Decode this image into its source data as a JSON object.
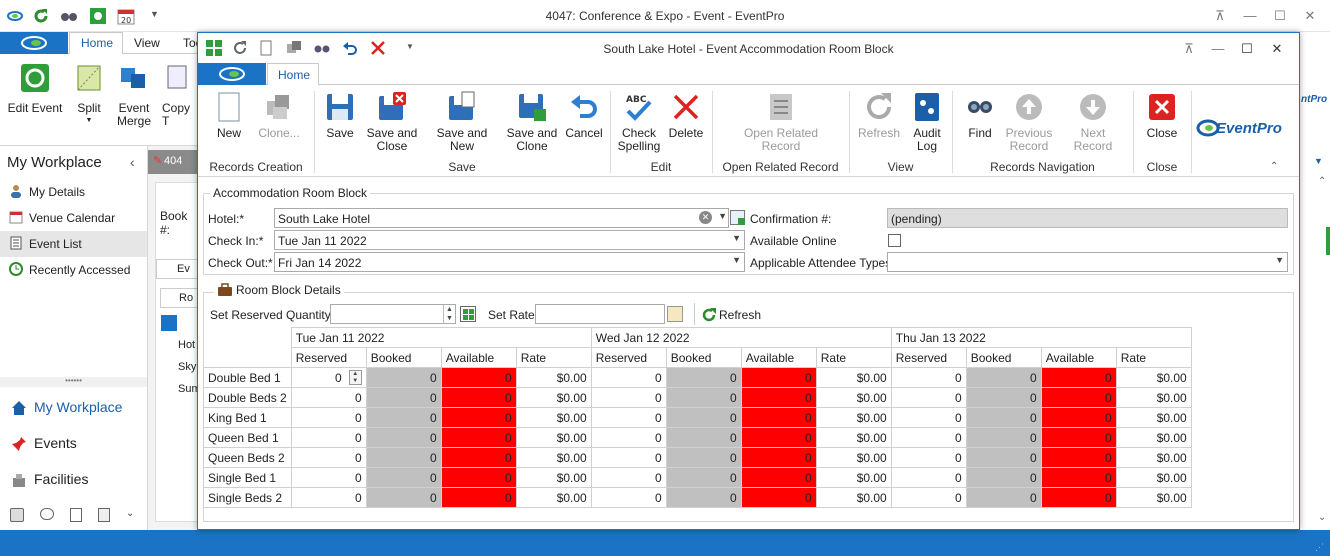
{
  "main_window": {
    "title": "4047: Conference & Expo - Event - EventPro",
    "tabs": [
      "Home",
      "View",
      "Too"
    ],
    "ribbon": [
      {
        "label": "Edit Event"
      },
      {
        "label": "Split"
      },
      {
        "label": "Event Merge"
      },
      {
        "label": "Copy T"
      }
    ]
  },
  "sidebar": {
    "title": "My Workplace",
    "items": [
      "My Details",
      "Venue Calendar",
      "Event List",
      "Recently Accessed"
    ],
    "nav": [
      "My Workplace",
      "Events",
      "Facilities"
    ]
  },
  "background_panel": {
    "tab_label": "404",
    "book_label": "Book #:",
    "tab2": "Ev",
    "tab3": "Ro",
    "rows": [
      "Hot",
      "Sky",
      "Sum"
    ]
  },
  "child_window": {
    "title": "South Lake Hotel - Event Accommodation Room Block",
    "tab": "Home",
    "ribbon": {
      "buttons": [
        {
          "id": "new",
          "label": "New"
        },
        {
          "id": "clone",
          "label": "Clone..."
        },
        {
          "id": "save",
          "label": "Save"
        },
        {
          "id": "save_close",
          "label": "Save and Close"
        },
        {
          "id": "save_new",
          "label": "Save and New"
        },
        {
          "id": "save_clone",
          "label": "Save and Clone"
        },
        {
          "id": "cancel",
          "label": "Cancel"
        },
        {
          "id": "check_spelling",
          "label": "Check Spelling"
        },
        {
          "id": "delete",
          "label": "Delete"
        },
        {
          "id": "open_related",
          "label": "Open Related Record"
        },
        {
          "id": "refresh",
          "label": "Refresh"
        },
        {
          "id": "audit_log",
          "label": "Audit Log"
        },
        {
          "id": "find",
          "label": "Find"
        },
        {
          "id": "prev",
          "label": "Previous Record"
        },
        {
          "id": "next",
          "label": "Next Record"
        },
        {
          "id": "close",
          "label": "Close"
        }
      ],
      "groups": [
        "Records Creation",
        "Save",
        "Edit",
        "Open Related Record",
        "View",
        "Records Navigation",
        "Close"
      ],
      "logo_text": "EventPro"
    },
    "form": {
      "section_title": "Accommodation Room Block",
      "hotel_label": "Hotel:*",
      "hotel_value": "South Lake Hotel",
      "checkin_label": "Check In:*",
      "checkin_value": "Tue Jan 11 2022",
      "checkout_label": "Check Out:*",
      "checkout_value": "Fri Jan 14 2022",
      "confirmation_label": "Confirmation #:",
      "confirmation_value": "(pending)",
      "available_online_label": "Available Online",
      "attendee_types_label": "Applicable Attendee Types:",
      "attendee_types_value": ""
    },
    "room_block": {
      "section_title": "Room Block Details",
      "set_qty_label": "Set Reserved Quantity",
      "set_rate_label": "Set Rate",
      "refresh_label": "Refresh",
      "dates": [
        "Tue Jan 11 2022",
        "Wed Jan 12 2022",
        "Thu Jan 13 2022"
      ],
      "columns": [
        "Reserved",
        "Booked",
        "Available",
        "Rate"
      ],
      "rows": [
        {
          "room": "Double Bed 1",
          "values": [
            "0",
            "0",
            "0",
            "$0.00",
            "0",
            "0",
            "0",
            "$0.00",
            "0",
            "0",
            "0",
            "$0.00"
          ]
        },
        {
          "room": "Double Beds 2",
          "values": [
            "0",
            "0",
            "0",
            "$0.00",
            "0",
            "0",
            "0",
            "$0.00",
            "0",
            "0",
            "0",
            "$0.00"
          ]
        },
        {
          "room": "King Bed 1",
          "values": [
            "0",
            "0",
            "0",
            "$0.00",
            "0",
            "0",
            "0",
            "$0.00",
            "0",
            "0",
            "0",
            "$0.00"
          ]
        },
        {
          "room": "Queen Bed 1",
          "values": [
            "0",
            "0",
            "0",
            "$0.00",
            "0",
            "0",
            "0",
            "$0.00",
            "0",
            "0",
            "0",
            "$0.00"
          ]
        },
        {
          "room": "Queen Beds 2",
          "values": [
            "0",
            "0",
            "0",
            "$0.00",
            "0",
            "0",
            "0",
            "$0.00",
            "0",
            "0",
            "0",
            "$0.00"
          ]
        },
        {
          "room": "Single Bed 1",
          "values": [
            "0",
            "0",
            "0",
            "$0.00",
            "0",
            "0",
            "0",
            "$0.00",
            "0",
            "0",
            "0",
            "$0.00"
          ]
        },
        {
          "room": "Single Beds 2",
          "values": [
            "0",
            "0",
            "0",
            "$0.00",
            "0",
            "0",
            "0",
            "$0.00",
            "0",
            "0",
            "0",
            "$0.00"
          ]
        }
      ]
    }
  },
  "colors": {
    "accent": "#1a73c4",
    "available": "#ff0000",
    "booked": "#c0c0c0"
  }
}
